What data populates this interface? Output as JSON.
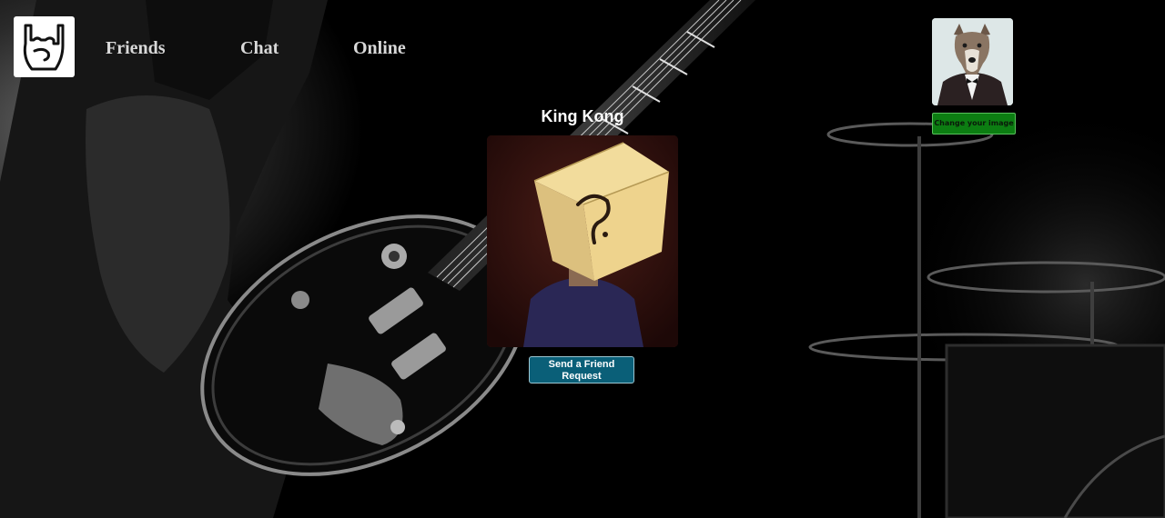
{
  "nav": {
    "friends_label": "Friends",
    "chat_label": "Chat",
    "online_label": "Online"
  },
  "user": {
    "change_image_label": "Change your image"
  },
  "profile": {
    "name": "King Kong",
    "send_request_label": "Send a Friend Request"
  },
  "icons": {
    "logo": "rock-hand-icon",
    "avatar": "wolf-in-suit-image",
    "profile_photo": "box-head-question-mark-image"
  },
  "colors": {
    "nav_text": "#d9d9d9",
    "change_image_button": "#0c7d12",
    "friend_button": "#0a5f78",
    "background": "#000000"
  }
}
